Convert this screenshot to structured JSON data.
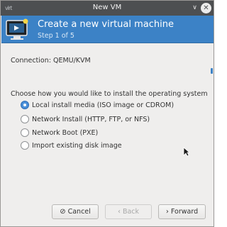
{
  "window": {
    "title": "New VM",
    "logo_text": "virt",
    "minimize_icon": "chevron-down-icon",
    "close_icon": "close-icon"
  },
  "banner": {
    "title": "Create a new virtual machine",
    "step": "Step 1 of 5",
    "icon": "vm-monitor-icon",
    "color": "#3c82c6"
  },
  "connection": {
    "label": "Connection:  QEMU/KVM"
  },
  "install": {
    "prompt": "Choose how you would like to install the operating system",
    "options": [
      {
        "label": "Local install media (ISO image or CDROM)",
        "checked": true
      },
      {
        "label": "Network Install (HTTP, FTP, or NFS)",
        "checked": false
      },
      {
        "label": "Network Boot (PXE)",
        "checked": false
      },
      {
        "label": "Import existing disk image",
        "checked": false
      }
    ]
  },
  "buttons": {
    "cancel": "Cancel",
    "back": "Back",
    "forward": "Forward"
  }
}
